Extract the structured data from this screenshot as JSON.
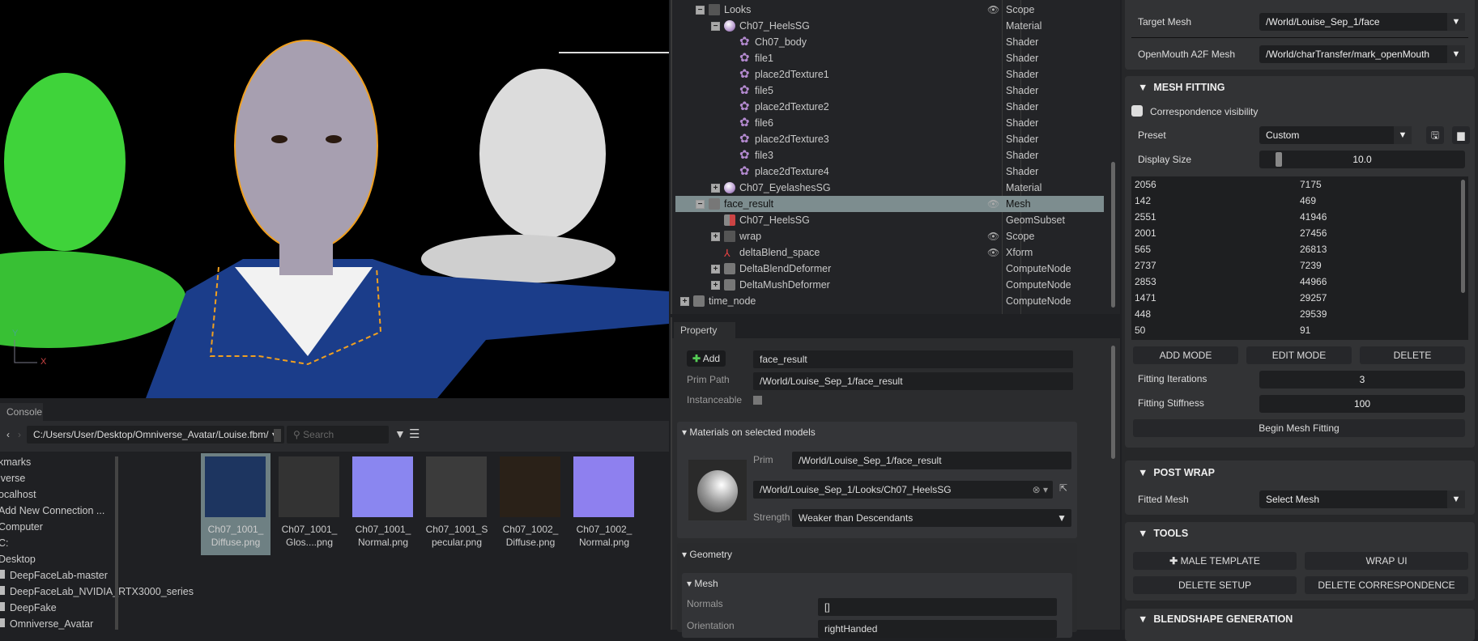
{
  "viewport": {
    "axis_y": "Y",
    "axis_x": "X"
  },
  "stage": {
    "rows": [
      {
        "label": "Looks",
        "type": "Scope",
        "indent": 1,
        "expander": "minus",
        "icon": "folder",
        "eye": true
      },
      {
        "label": "Ch07_HeelsSG",
        "type": "Material",
        "indent": 2,
        "expander": "minus",
        "icon": "material"
      },
      {
        "label": "Ch07_body",
        "type": "Shader",
        "indent": 3,
        "icon": "shader"
      },
      {
        "label": "file1",
        "type": "Shader",
        "indent": 3,
        "icon": "shader"
      },
      {
        "label": "place2dTexture1",
        "type": "Shader",
        "indent": 3,
        "icon": "shader"
      },
      {
        "label": "file5",
        "type": "Shader",
        "indent": 3,
        "icon": "shader"
      },
      {
        "label": "place2dTexture2",
        "type": "Shader",
        "indent": 3,
        "icon": "shader"
      },
      {
        "label": "file6",
        "type": "Shader",
        "indent": 3,
        "icon": "shader"
      },
      {
        "label": "place2dTexture3",
        "type": "Shader",
        "indent": 3,
        "icon": "shader"
      },
      {
        "label": "file3",
        "type": "Shader",
        "indent": 3,
        "icon": "shader"
      },
      {
        "label": "place2dTexture4",
        "type": "Shader",
        "indent": 3,
        "icon": "shader"
      },
      {
        "label": "Ch07_EyelashesSG",
        "type": "Material",
        "indent": 2,
        "expander": "plus",
        "icon": "material"
      },
      {
        "label": "face_result",
        "type": "Mesh",
        "indent": 1,
        "expander": "minus",
        "icon": "mesh",
        "eye": true,
        "selected": true
      },
      {
        "label": "Ch07_HeelsSG",
        "type": "GeomSubset",
        "indent": 2,
        "icon": "subset"
      },
      {
        "label": "wrap",
        "type": "Scope",
        "indent": 2,
        "expander": "plus",
        "icon": "folder",
        "eye": true
      },
      {
        "label": "deltaBlend_space",
        "type": "Xform",
        "indent": 2,
        "icon": "xform",
        "eye": true
      },
      {
        "label": "DeltaBlendDeformer",
        "type": "ComputeNode",
        "indent": 2,
        "expander": "plus",
        "icon": "mesh"
      },
      {
        "label": "DeltaMushDeformer",
        "type": "ComputeNode",
        "indent": 2,
        "expander": "plus",
        "icon": "mesh"
      },
      {
        "label": "time_node",
        "type": "ComputeNode",
        "indent": 0,
        "expander": "plus",
        "icon": "mesh"
      }
    ]
  },
  "property": {
    "tab": "Property",
    "add_label": "Add",
    "name_value": "face_result",
    "prim_path_label": "Prim Path",
    "prim_path": "/World/Louise_Sep_1/face_result",
    "instanceable_label": "Instanceable",
    "materials": {
      "title": "Materials on selected models",
      "prim_label": "Prim",
      "prim": "/World/Louise_Sep_1/face_result",
      "material": "/World/Louise_Sep_1/Looks/Ch07_HeelsSG",
      "strength_label": "Strength",
      "strength": "Weaker than Descendants"
    },
    "geometry": {
      "title": "Geometry",
      "mesh_title": "Mesh",
      "normals_label": "Normals",
      "normals": "[]",
      "orientation_label": "Orientation",
      "orientation": "rightHanded"
    }
  },
  "right": {
    "target_mesh_label": "Target Mesh",
    "target_mesh": "/World/Louise_Sep_1/face",
    "openmouth_label": "OpenMouth A2F Mesh",
    "openmouth": "/World/charTransfer/mark_openMouth",
    "mesh_fitting": {
      "title": "MESH FITTING",
      "corr_label": "Correspondence visibility",
      "preset_label": "Preset",
      "preset": "Custom",
      "display_size_label": "Display Size",
      "display_size": "10.0",
      "display_size_fraction": 0.05,
      "pairs": [
        [
          "2056",
          "7175"
        ],
        [
          "142",
          "469"
        ],
        [
          "2551",
          "41946"
        ],
        [
          "2001",
          "27456"
        ],
        [
          "565",
          "26813"
        ],
        [
          "2737",
          "7239"
        ],
        [
          "2853",
          "44966"
        ],
        [
          "1471",
          "29257"
        ],
        [
          "448",
          "29539"
        ],
        [
          "50",
          "91"
        ]
      ],
      "add_mode": "ADD MODE",
      "edit_mode": "EDIT MODE",
      "delete": "DELETE",
      "iter_label": "Fitting Iterations",
      "iter": "3",
      "stiff_label": "Fitting Stiffness",
      "stiff": "100",
      "begin": "Begin Mesh Fitting"
    },
    "post_wrap": {
      "title": "POST WRAP",
      "fitted_label": "Fitted Mesh",
      "fitted": "Select Mesh"
    },
    "tools": {
      "title": "TOOLS",
      "male": "MALE TEMPLATE",
      "wrap_ui": "WRAP UI",
      "delete_setup": "DELETE SETUP",
      "delete_corr": "DELETE CORRESPONDENCE"
    },
    "blendshape": {
      "title": "BLENDSHAPE GENERATION"
    }
  },
  "browser": {
    "tab": "Console",
    "path": "C:/Users/User/Desktop/Omniverse_Avatar/Louise.fbm/",
    "search_placeholder": "Search",
    "tree": [
      "kmarks",
      "iverse",
      "ocalhost",
      "Add New Connection ...",
      "Computer",
      "C:",
      "Desktop",
      "DeepFaceLab-master",
      "DeepFaceLab_NVIDIA_RTX3000_series",
      "DeepFake",
      "Omniverse_Avatar"
    ],
    "files": [
      {
        "l1": "Ch07_1001_",
        "l2": "Diffuse.png",
        "color": "#1d3560",
        "selected": true
      },
      {
        "l1": "Ch07_1001_",
        "l2": "Glos....png",
        "color": "#333"
      },
      {
        "l1": "Ch07_1001_",
        "l2": "Normal.png",
        "color": "#8a86f0"
      },
      {
        "l1": "Ch07_1001_S",
        "l2": "pecular.png",
        "color": "#3b3b3b"
      },
      {
        "l1": "Ch07_1002_",
        "l2": "Diffuse.png",
        "color": "#2a2118"
      },
      {
        "l1": "Ch07_1002_",
        "l2": "Normal.png",
        "color": "#8e80ef"
      }
    ]
  }
}
